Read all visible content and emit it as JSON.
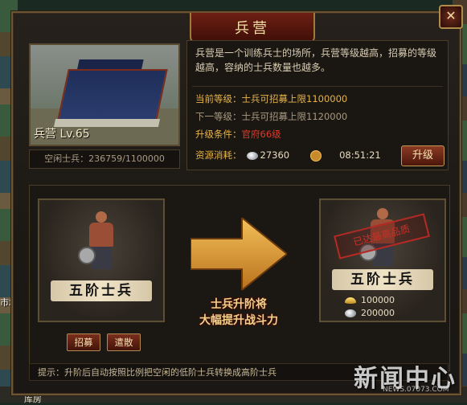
{
  "window": {
    "title": "兵营",
    "close": "✕"
  },
  "building": {
    "name_level": "兵营  Lv.65",
    "idle_soldiers": "空闲士兵：236759/1100000"
  },
  "info": {
    "description": "兵营是一个训练兵士的场所，兵营等级越高，招募的等级越高，容纳的士兵数量也越多。",
    "current_label": "当前等级：",
    "current_value": "士兵可招募上限1100000",
    "next_label": "下一等级：",
    "next_value": "士兵可招募上限1120000",
    "condition_label": "升级条件：",
    "condition_value": "官府66级",
    "resource_label": "资源消耗：",
    "resource_silver": "27360",
    "resource_time": "08:51:21",
    "upgrade_button": "升级"
  },
  "soldiers": {
    "current_rank": "五阶士兵",
    "next_rank": "五阶士兵",
    "max_stamp": "已达最高品质",
    "cost_gold": "100000",
    "cost_silver": "200000",
    "recruit_button": "招募",
    "dismiss_button": "遣散",
    "promo_line1": "士兵升阶将",
    "promo_line2": "大幅提升战斗力"
  },
  "hint": "提示：升阶后自动按照比例把空闲的低阶士兵转换成高阶士兵",
  "watermark": {
    "main": "新闻中心",
    "sub": "NEWS.07073.COM"
  },
  "background": {
    "left_label": "市场",
    "bottom_label": "库房"
  }
}
